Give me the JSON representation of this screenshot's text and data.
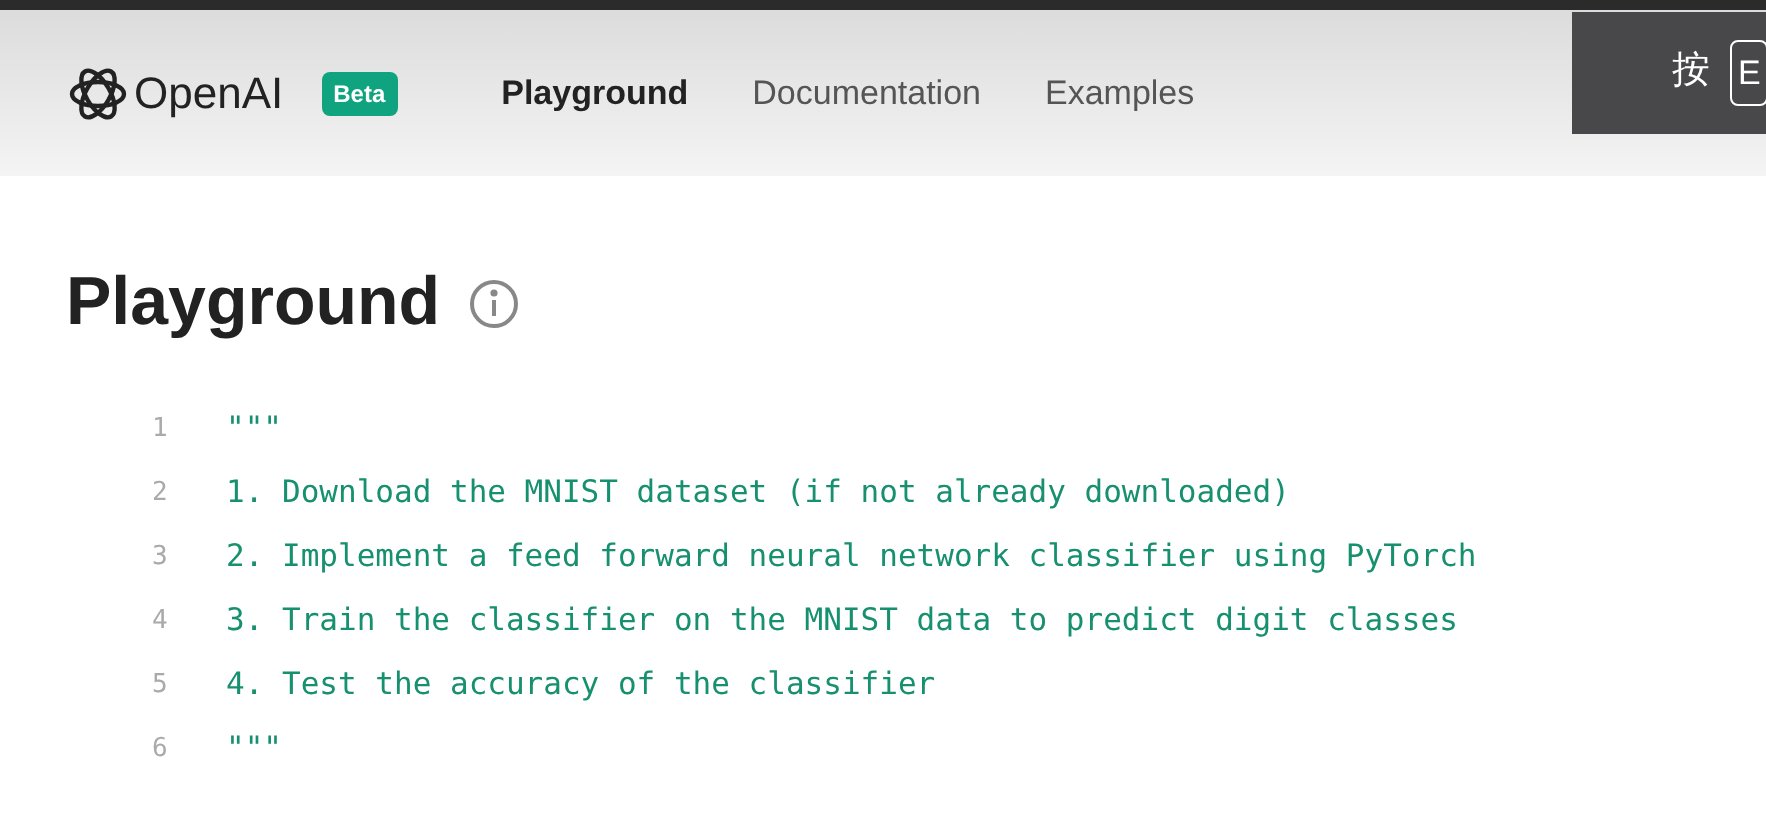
{
  "header": {
    "logo": "OpenAI",
    "badge": "Beta",
    "nav": [
      {
        "label": "Playground",
        "selected": true
      },
      {
        "label": "Documentation",
        "selected": false
      },
      {
        "label": "Examples",
        "selected": false
      }
    ]
  },
  "fullscreen_hint": {
    "text": "按",
    "key": "E"
  },
  "page": {
    "title": "Playground"
  },
  "editor": {
    "lines": [
      {
        "number": "1",
        "text": "\"\"\""
      },
      {
        "number": "2",
        "text": "1. Download the MNIST dataset (if not already downloaded)"
      },
      {
        "number": "3",
        "text": "2. Implement a feed forward neural network classifier using PyTorch"
      },
      {
        "number": "4",
        "text": "3. Train the classifier on the MNIST data to predict digit classes"
      },
      {
        "number": "5",
        "text": "4. Test the accuracy of the classifier"
      },
      {
        "number": "6",
        "text": "\"\"\""
      }
    ]
  }
}
